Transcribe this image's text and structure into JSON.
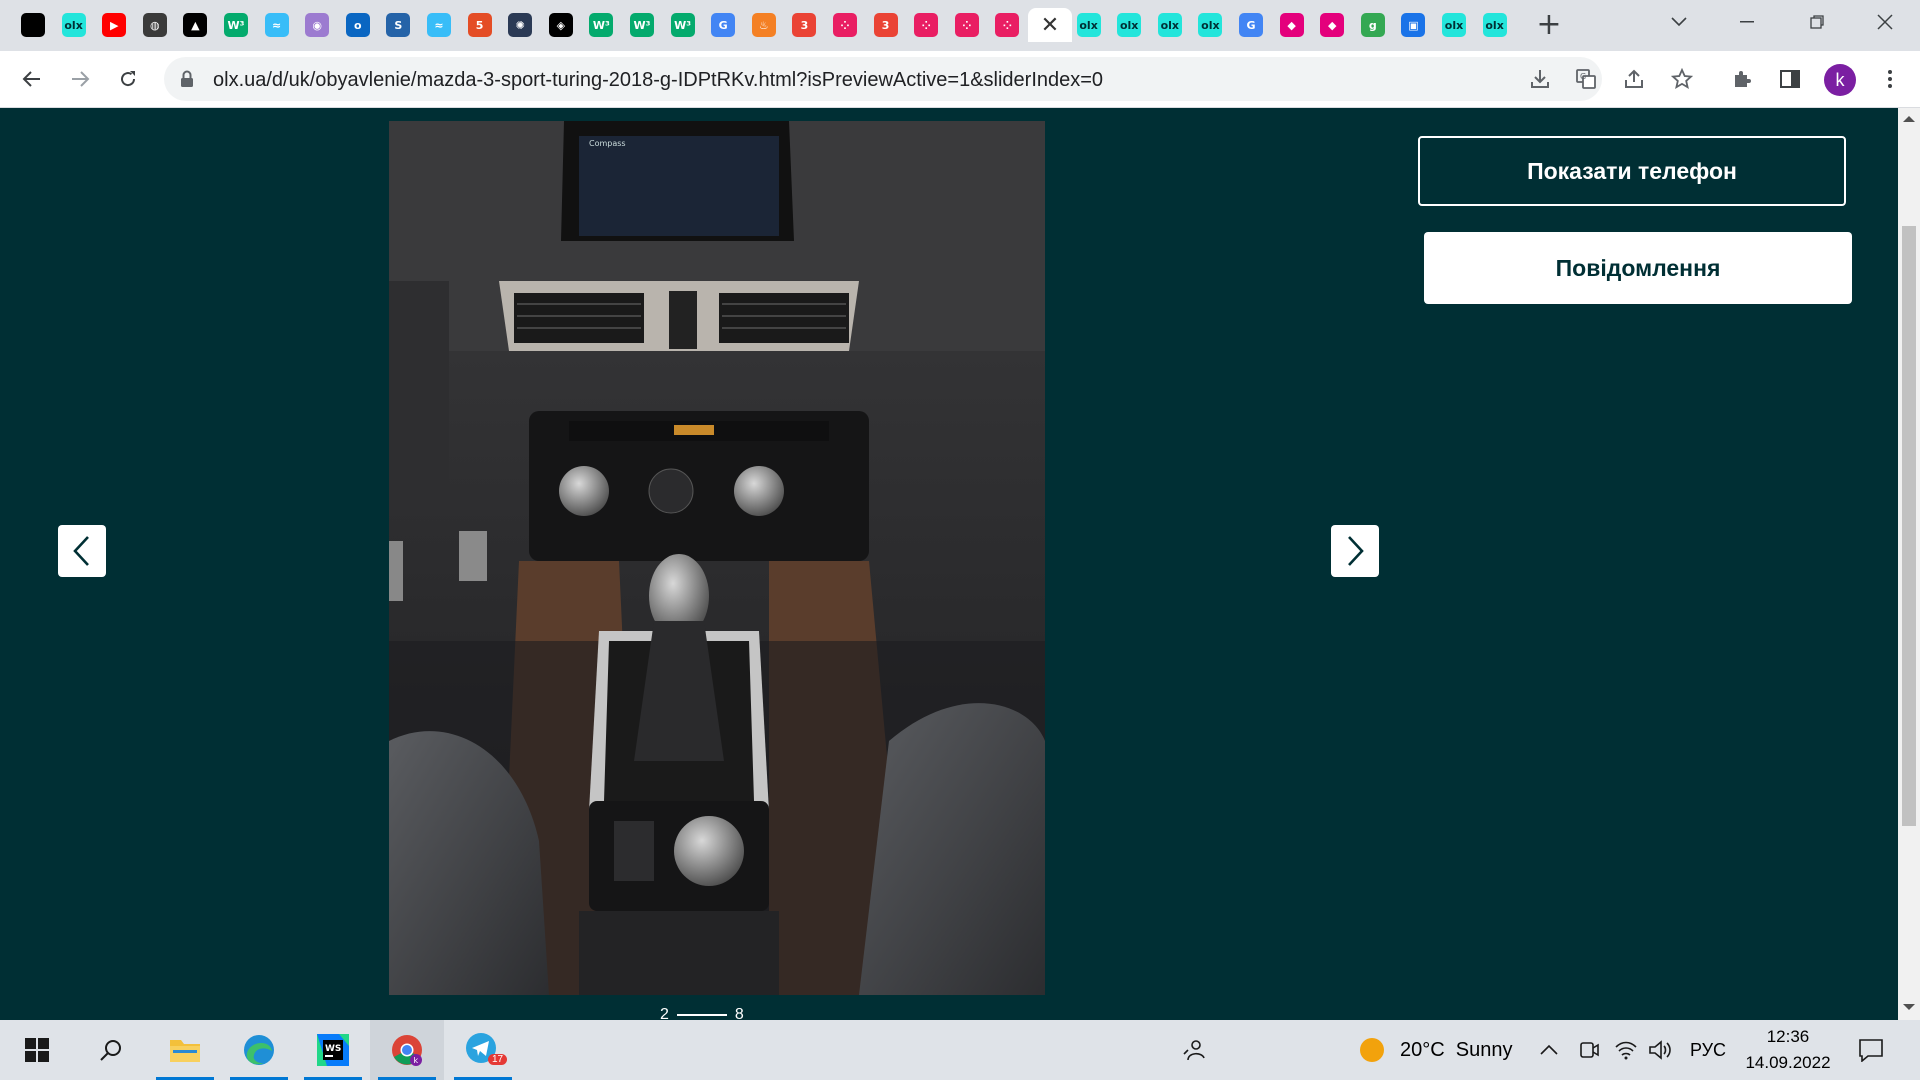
{
  "browser": {
    "tabs": [
      {
        "icon": "codepen-icon",
        "label": "",
        "color": "#000000"
      },
      {
        "icon": "olx-icon",
        "label": "olx",
        "color": "#23e5db"
      },
      {
        "icon": "youtube-icon",
        "label": "▶",
        "color": "#ff0000"
      },
      {
        "icon": "github-icon",
        "label": "◍",
        "color": "#3a3a3a"
      },
      {
        "icon": "triangle-icon",
        "label": "▲",
        "color": "#000000"
      },
      {
        "icon": "w3schools-icon",
        "label": "W³",
        "color": "#04aa6d"
      },
      {
        "icon": "tailwind-icon",
        "label": "≈",
        "color": "#38bdf8"
      },
      {
        "icon": "owl-icon",
        "label": "◉",
        "color": "#9c7bd0"
      },
      {
        "icon": "outlook-icon",
        "label": "o",
        "color": "#0a66c2"
      },
      {
        "icon": "stackoverflow-icon",
        "label": "S",
        "color": "#2563a8"
      },
      {
        "icon": "tailwind-icon",
        "label": "≈",
        "color": "#38bdf8"
      },
      {
        "icon": "html5-icon",
        "label": "5",
        "color": "#e44d26"
      },
      {
        "icon": "settings-icon",
        "label": "✺",
        "color": "#2b3a55"
      },
      {
        "icon": "codepen-icon",
        "label": "◈",
        "color": "#000000"
      },
      {
        "icon": "w3schools-icon",
        "label": "W³",
        "color": "#04aa6d"
      },
      {
        "icon": "w3schools-icon",
        "label": "W³",
        "color": "#04aa6d"
      },
      {
        "icon": "w3schools-icon",
        "label": "W³",
        "color": "#04aa6d"
      },
      {
        "icon": "google-icon",
        "label": "G",
        "color": "#4285f4"
      },
      {
        "icon": "flame-icon",
        "label": "♨",
        "color": "#f48024"
      },
      {
        "icon": "badge-icon",
        "label": "3",
        "color": "#ea4335"
      },
      {
        "icon": "dots-icon",
        "label": "⁘",
        "color": "#e91e63"
      },
      {
        "icon": "badge-icon",
        "label": "3",
        "color": "#ea4335"
      },
      {
        "icon": "dots-icon",
        "label": "⁘",
        "color": "#e91e63"
      },
      {
        "icon": "dots-icon",
        "label": "⁘",
        "color": "#e91e63"
      },
      {
        "icon": "dots-icon",
        "label": "⁘",
        "color": "#e91e63"
      },
      {
        "icon": "close-icon",
        "label": "✕",
        "color": "#ffffff",
        "active": true
      },
      {
        "icon": "olx-icon",
        "label": "olx",
        "color": "#23e5db"
      },
      {
        "icon": "olx-icon",
        "label": "olx",
        "color": "#23e5db"
      },
      {
        "icon": "olx-icon",
        "label": "olx",
        "color": "#23e5db"
      },
      {
        "icon": "olx-icon",
        "label": "olx",
        "color": "#23e5db"
      },
      {
        "icon": "google-icon",
        "label": "G",
        "color": "#4285f4"
      },
      {
        "icon": "tag-icon",
        "label": "◆",
        "color": "#e4007c"
      },
      {
        "icon": "tag-icon",
        "label": "◆",
        "color": "#e4007c"
      },
      {
        "icon": "g-icon",
        "label": "g",
        "color": "#34a853"
      },
      {
        "icon": "chat-icon",
        "label": "▣",
        "color": "#1a73e8"
      },
      {
        "icon": "olx-icon",
        "label": "olx",
        "color": "#23e5db"
      },
      {
        "icon": "olx-icon",
        "label": "olx",
        "color": "#23e5db"
      }
    ],
    "new_tab": "+",
    "url": "olx.ua/d/uk/obyavlenie/mazda-3-sport-turing-2018-g-IDPtRKv.html?isPreviewActive=1&sliderIndex=0",
    "avatar_initial": "k"
  },
  "gallery": {
    "counter_current": "2",
    "counter_total": "8"
  },
  "actions": {
    "show_phone": "Показати телефон",
    "message": "Повідомлення"
  },
  "taskbar": {
    "weather": "20°C  Sunny",
    "language": "РУС",
    "time": "12:36",
    "date": "14.09.2022",
    "telegram_badge": "17"
  },
  "colors": {
    "olx_dark": "#002f34",
    "taskbar": "#dfe3e8",
    "tabstrip": "#dee1e6"
  }
}
